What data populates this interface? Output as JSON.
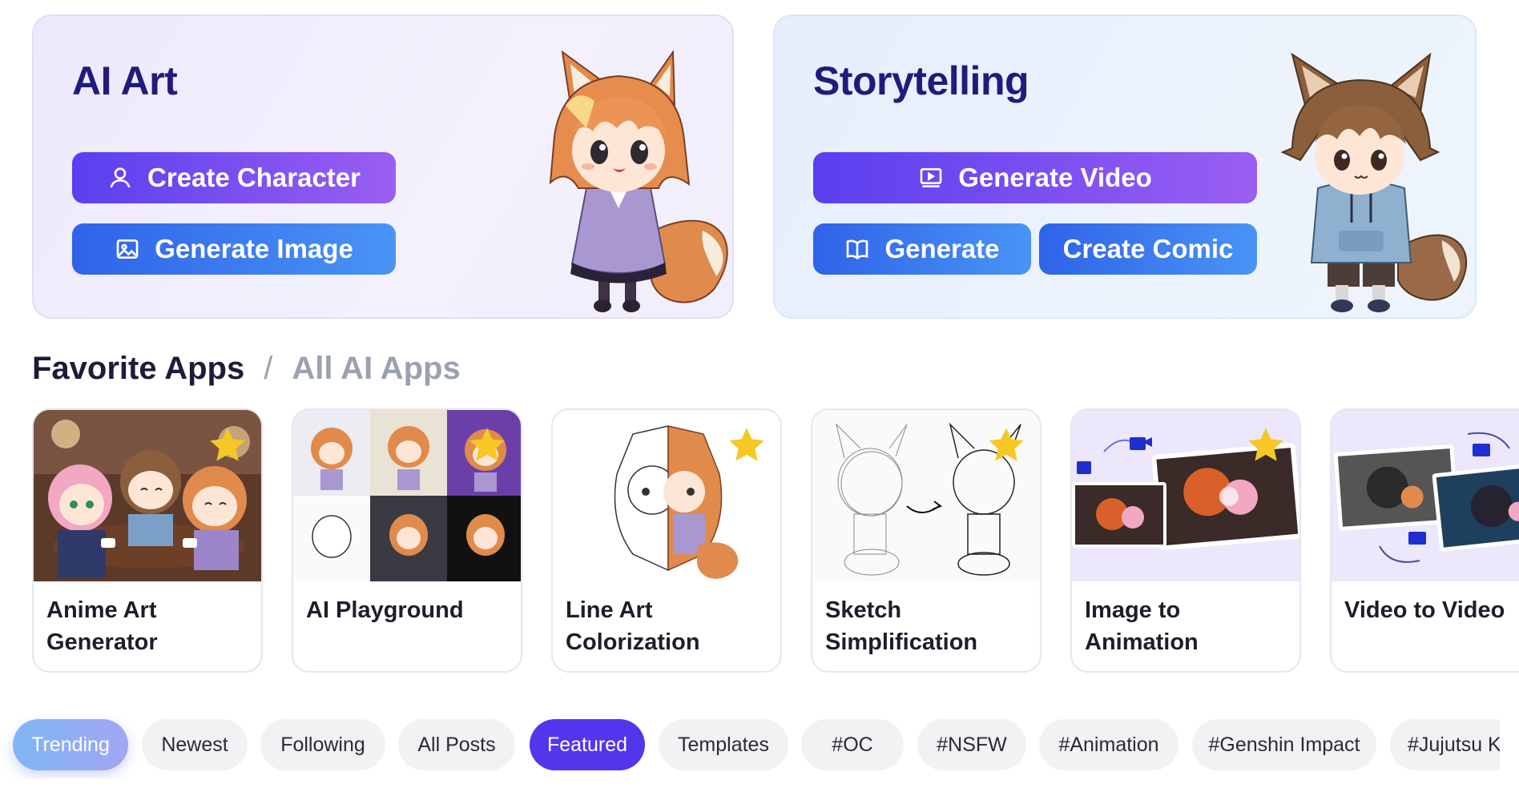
{
  "hero_ai": {
    "title": "AI Art",
    "create_character_label": "Create Character",
    "generate_image_label": "Generate Image"
  },
  "hero_story": {
    "title": "Storytelling",
    "generate_video_label": "Generate Video",
    "generate_label": "Generate",
    "create_comic_label": "Create Comic"
  },
  "section": {
    "active": "Favorite Apps",
    "separator": "/",
    "other": "All AI Apps"
  },
  "apps": [
    {
      "label": "Anime Art Generator",
      "favorited": true
    },
    {
      "label": "AI Playground",
      "favorited": true
    },
    {
      "label": "Line Art Colorization",
      "favorited": true
    },
    {
      "label": "Sketch Simplification",
      "favorited": true
    },
    {
      "label": "Image to Animation",
      "favorited": true
    },
    {
      "label": "Video to Video",
      "favorited": true
    }
  ],
  "tags": [
    {
      "label": "Trending",
      "state": "active"
    },
    {
      "label": "Newest"
    },
    {
      "label": "Following"
    },
    {
      "label": "All Posts"
    },
    {
      "label": "Featured",
      "state": "selected"
    },
    {
      "label": "Templates"
    },
    {
      "label": "#OC"
    },
    {
      "label": "#NSFW"
    },
    {
      "label": "#Animation"
    },
    {
      "label": "#Genshin Impact"
    },
    {
      "label": "#Jujutsu Ka"
    }
  ],
  "colors": {
    "title": "#221a7c",
    "purple_button": "#5a3ff0",
    "blue_button": "#2f63e8",
    "featured_tag": "#5435ec",
    "star": "#f5c825"
  },
  "icons": [
    "user-icon",
    "image-icon",
    "video-icon",
    "book-icon",
    "star-icon"
  ]
}
